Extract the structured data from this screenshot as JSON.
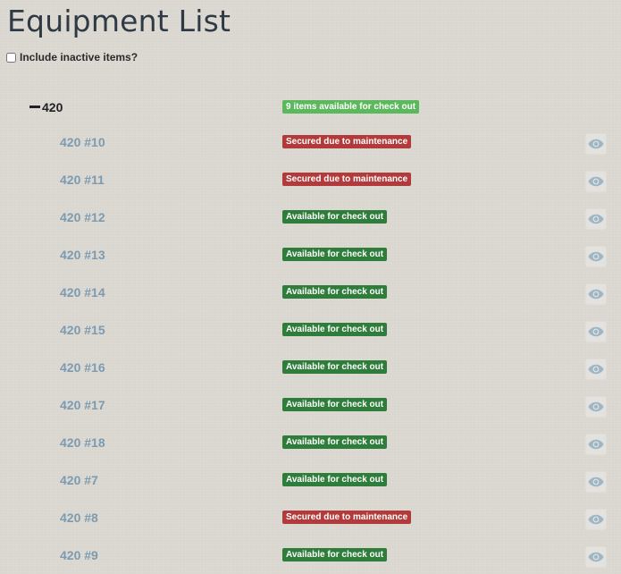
{
  "page": {
    "title": "Equipment List"
  },
  "filters": {
    "include_inactive_label": "Include inactive items?",
    "include_inactive_checked": false
  },
  "colors": {
    "group_badge": "#5cb85c",
    "available": "#2f7d3b",
    "maintenance": "#b23a3a",
    "item_link": "#7c9bb0"
  },
  "group": {
    "name": "420",
    "collapse_icon": "minus-icon",
    "badge": "9 items available for check out",
    "badge_color": "#5cb85c"
  },
  "items": [
    {
      "name": "420 #10",
      "status": "Secured due to maintenance",
      "status_color": "#b23a3a"
    },
    {
      "name": "420 #11",
      "status": "Secured due to maintenance",
      "status_color": "#b23a3a"
    },
    {
      "name": "420 #12",
      "status": "Available for check out",
      "status_color": "#2f7d3b"
    },
    {
      "name": "420 #13",
      "status": "Available for check out",
      "status_color": "#2f7d3b"
    },
    {
      "name": "420 #14",
      "status": "Available for check out",
      "status_color": "#2f7d3b"
    },
    {
      "name": "420 #15",
      "status": "Available for check out",
      "status_color": "#2f7d3b"
    },
    {
      "name": "420 #16",
      "status": "Available for check out",
      "status_color": "#2f7d3b"
    },
    {
      "name": "420 #17",
      "status": "Available for check out",
      "status_color": "#2f7d3b"
    },
    {
      "name": "420 #18",
      "status": "Available for check out",
      "status_color": "#2f7d3b"
    },
    {
      "name": "420 #7",
      "status": "Available for check out",
      "status_color": "#2f7d3b"
    },
    {
      "name": "420 #8",
      "status": "Secured due to maintenance",
      "status_color": "#b23a3a"
    },
    {
      "name": "420 #9",
      "status": "Available for check out",
      "status_color": "#2f7d3b"
    }
  ],
  "icons": {
    "view": "eye-icon"
  }
}
